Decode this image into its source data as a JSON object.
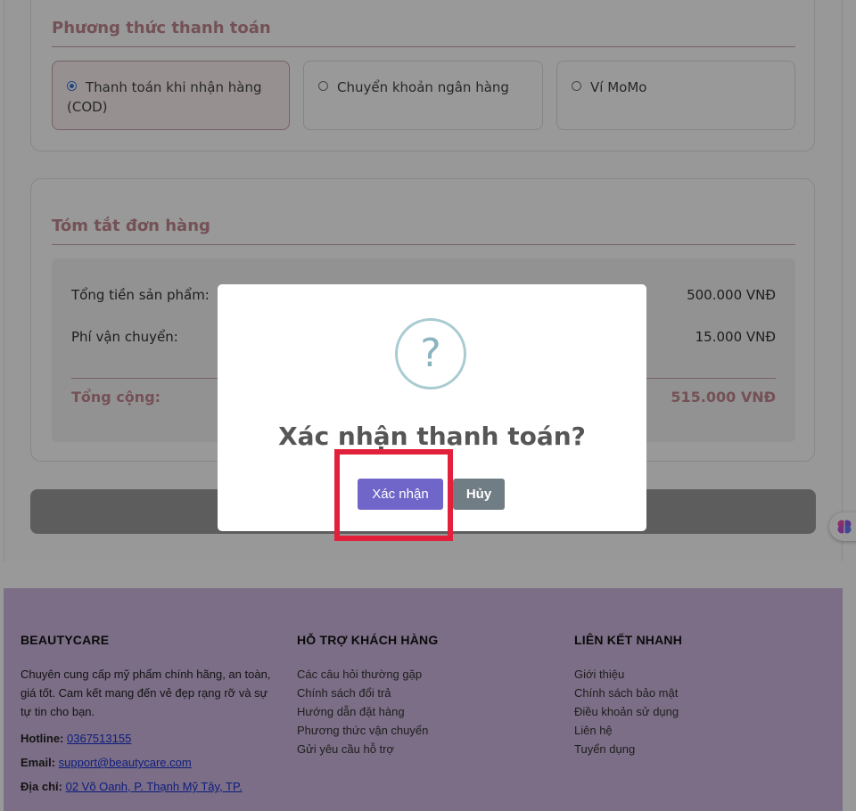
{
  "payment": {
    "title": "Phương thức thanh toán",
    "options": [
      {
        "label": "Thanh toán khi nhận hàng (COD)",
        "selected": true
      },
      {
        "label": "Chuyển khoản ngân hàng",
        "selected": false
      },
      {
        "label": "Ví MoMo",
        "selected": false
      }
    ]
  },
  "summary": {
    "title": "Tóm tắt đơn hàng",
    "subtotal_label": "Tổng tiền sản phẩm:",
    "subtotal_value": "500.000 VNĐ",
    "shipping_label": "Phí vận chuyển:",
    "shipping_value": "15.000 VNĐ",
    "total_label": "Tổng cộng:",
    "total_value": "515.000 VNĐ"
  },
  "modal": {
    "icon": "?",
    "title": "Xác nhận thanh toán?",
    "confirm_label": "Xác nhận",
    "cancel_label": "Hủy"
  },
  "footer": {
    "brand": {
      "heading": "BEAUTYCARE",
      "description": "Chuyên cung cấp mỹ phẩm chính hãng, an toàn, giá tốt. Cam kết mang đến vẻ đẹp rạng rỡ và sự tự tin cho bạn.",
      "hotline_label": "Hotline:",
      "hotline": "0367513155",
      "email_label": "Email:",
      "email": "support@beautycare.com",
      "address_label": "Địa chỉ:",
      "address": "02 Võ Oanh, P. Thạnh Mỹ Tây, TP."
    },
    "support": {
      "heading": "HỖ TRỢ KHÁCH HÀNG",
      "links": [
        "Các câu hỏi thường gặp",
        "Chính sách đổi trả",
        "Hướng dẫn đặt hàng",
        "Phương thức vận chuyển",
        "Gửi yêu cầu hỗ trợ"
      ]
    },
    "quick": {
      "heading": "LIÊN KẾT NHANH",
      "links": [
        "Giới thiệu",
        "Chính sách bảo mật",
        "Điều khoản sử dụng",
        "Liên hệ",
        "Tuyển dụng"
      ]
    }
  },
  "colors": {
    "accent": "#c28791",
    "confirm": "#7065c8",
    "cancel": "#717d84",
    "highlight": "#e3203c",
    "footer_bg": "#cdb8e0"
  }
}
